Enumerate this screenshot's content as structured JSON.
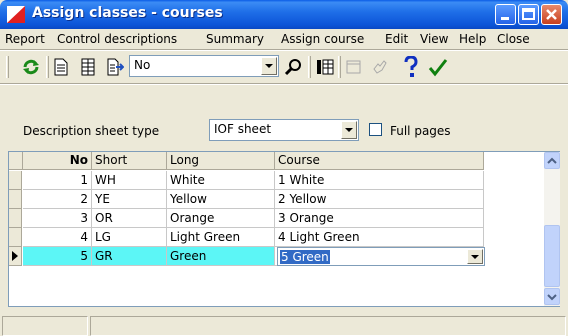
{
  "window": {
    "title": "Assign classes - courses",
    "colors": {
      "title_bar": "#0a5ce6",
      "selected_row": "#5cf6f6",
      "selection_highlight": "#316ac5"
    }
  },
  "menu": {
    "items": [
      {
        "label": "Report"
      },
      {
        "label": "Control descriptions"
      },
      {
        "label": "Summary"
      },
      {
        "label": "Assign course"
      },
      {
        "label": "Edit"
      },
      {
        "label": "View"
      },
      {
        "label": "Help"
      },
      {
        "label": "Close"
      }
    ]
  },
  "toolbar": {
    "refresh_icon": "refresh-icon",
    "print_icon": "page-icon",
    "table_icon": "table-icon",
    "export_icon": "export-icon",
    "filter_value": "No",
    "search_icon": "search-icon",
    "columns_icon": "columns-icon",
    "help_icon": "question-mark-icon",
    "ok_icon": "checkmark-icon"
  },
  "description": {
    "label": "Description sheet type",
    "sheet_type": "IOF sheet",
    "full_pages_label": "Full pages",
    "full_pages_checked": false
  },
  "grid": {
    "columns": {
      "no": "No",
      "short": "Short",
      "long": "Long",
      "course": "Course"
    },
    "rows": [
      {
        "no": "1",
        "short": "WH",
        "long": "White",
        "course": "1 White"
      },
      {
        "no": "2",
        "short": "YE",
        "long": "Yellow",
        "course": "2 Yellow"
      },
      {
        "no": "3",
        "short": "OR",
        "long": "Orange",
        "course": "3 Orange"
      },
      {
        "no": "4",
        "short": "LG",
        "long": "Light Green",
        "course": "4 Light Green"
      },
      {
        "no": "5",
        "short": "GR",
        "long": "Green",
        "course": "5 Green"
      }
    ],
    "selected_row": 5
  }
}
